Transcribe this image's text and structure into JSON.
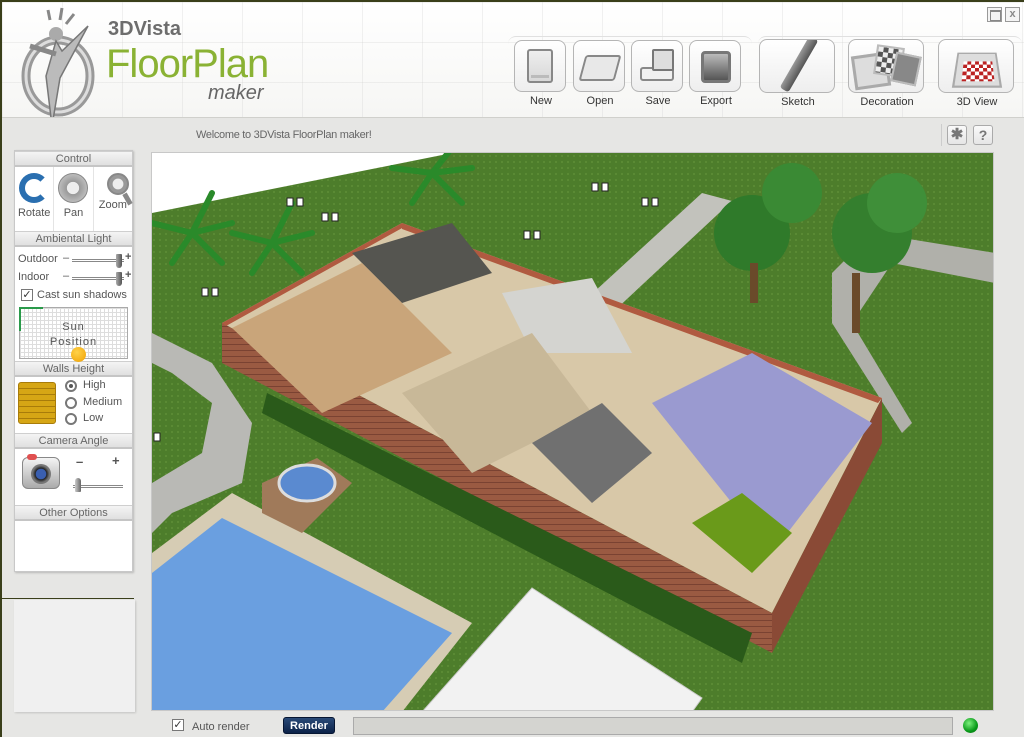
{
  "app": {
    "brand_small": "3DVista",
    "brand_big": "FloorPlan",
    "brand_sub": "maker"
  },
  "window": {
    "maximize_label": "",
    "close_label": "x"
  },
  "toolbar": {
    "file_buttons": [
      {
        "label": "New",
        "icon": "new-document-icon"
      },
      {
        "label": "Open",
        "icon": "open-folder-icon"
      },
      {
        "label": "Save",
        "icon": "save-disk-icon"
      },
      {
        "label": "Export",
        "icon": "export-icon"
      }
    ],
    "mode_buttons": [
      {
        "label": "Sketch",
        "icon": "pencil-icon"
      },
      {
        "label": "Decoration",
        "icon": "tiles-icon"
      },
      {
        "label": "3D View",
        "icon": "3d-room-icon"
      }
    ]
  },
  "status": {
    "welcome": "Welcome to 3DVista FloorPlan maker!",
    "settings_glyph": "✱",
    "help_glyph": "?"
  },
  "sidebar": {
    "control": {
      "title": "Control",
      "items": [
        {
          "label": "Rotate",
          "icon": "rotate-icon"
        },
        {
          "label": "Pan",
          "icon": "pan-icon"
        },
        {
          "label": "Zoom",
          "icon": "zoom-icon"
        }
      ]
    },
    "ambient_light": {
      "title": "Ambiental Light",
      "outdoor": {
        "label": "Outdoor",
        "minus": "–",
        "plus": "+",
        "value_fraction": 0.95
      },
      "indoor": {
        "label": "Indoor",
        "minus": "–",
        "plus": "+",
        "value_fraction": 0.95
      },
      "cast_shadows": {
        "label": "Cast sun shadows",
        "checked": true,
        "mark": "✓"
      },
      "sun_position": {
        "label_line1": "Sun",
        "label_line2": "Position"
      }
    },
    "walls_height": {
      "title": "Walls Height",
      "options": [
        {
          "label": "High",
          "selected": true
        },
        {
          "label": "Medium",
          "selected": false
        },
        {
          "label": "Low",
          "selected": false
        }
      ]
    },
    "camera_angle": {
      "title": "Camera Angle",
      "minus": "–",
      "plus": "+",
      "value_fraction": 0.05
    },
    "other_options": {
      "title": "Other Options"
    }
  },
  "bottom": {
    "auto_render": {
      "label": "Auto render",
      "checked": true,
      "mark": "✓"
    },
    "render_label": "Render",
    "progress_fraction": 0,
    "status_color": "#0a9a1a"
  },
  "colors": {
    "brand_green": "#8ab234",
    "render_button": "#0c2248",
    "grass": "#4a7a2a",
    "pool": "#6a9fe0",
    "brick": "#9a5a42"
  }
}
